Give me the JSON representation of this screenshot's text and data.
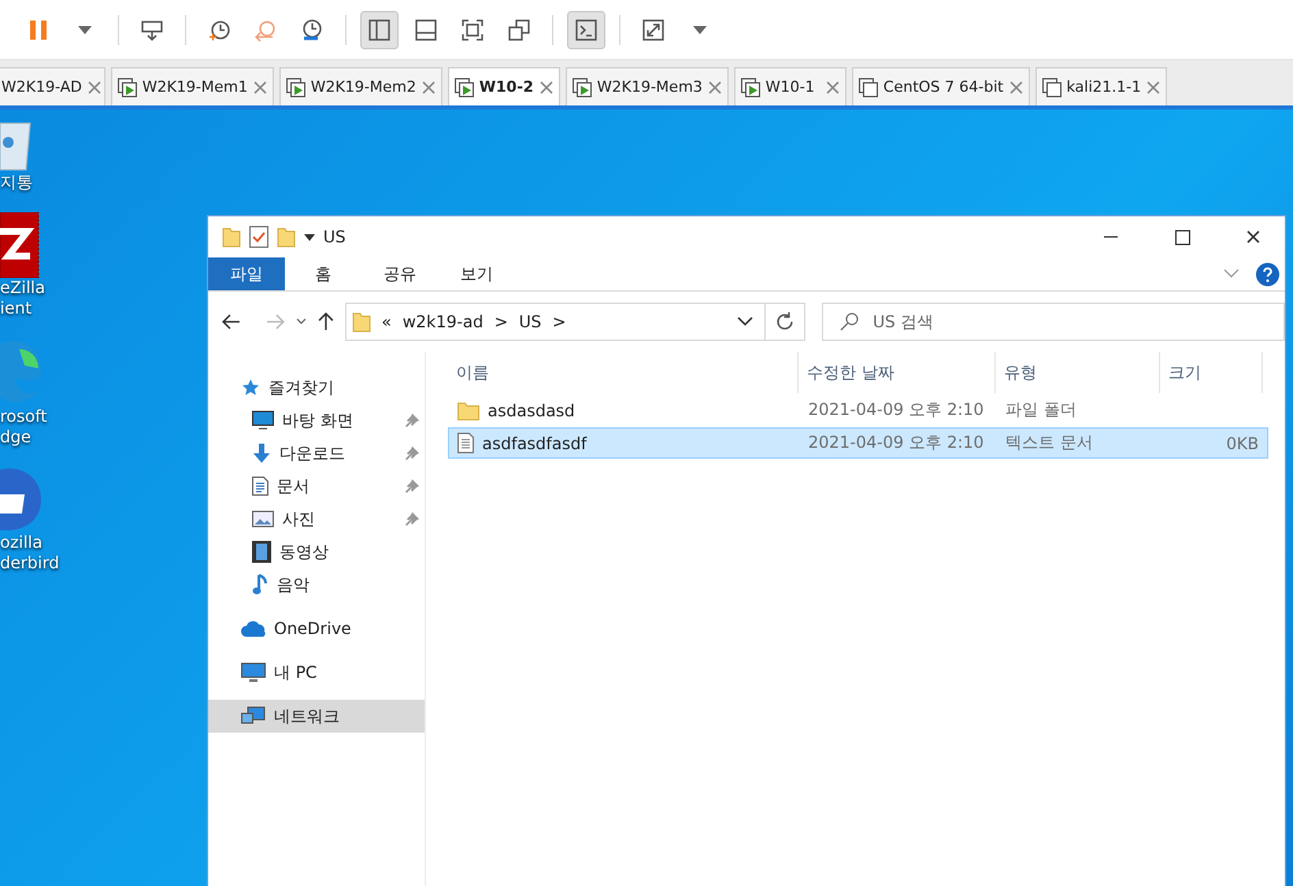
{
  "toolbar": {
    "groups": [
      [
        {
          "kind": "pause",
          "selected": false
        },
        {
          "kind": "caret",
          "selected": false
        }
      ],
      [
        {
          "kind": "send",
          "selected": false
        }
      ],
      [
        {
          "kind": "snapshot",
          "selected": false
        },
        {
          "kind": "revert",
          "selected": false
        },
        {
          "kind": "manage",
          "selected": false
        }
      ],
      [
        {
          "kind": "library",
          "selected": true
        },
        {
          "kind": "thumbs",
          "selected": false
        },
        {
          "kind": "fullscreen",
          "selected": false
        },
        {
          "kind": "unity",
          "selected": false
        }
      ],
      [
        {
          "kind": "console",
          "selected": true
        }
      ],
      [
        {
          "kind": "stretch",
          "selected": false
        },
        {
          "kind": "caret",
          "selected": false
        }
      ]
    ]
  },
  "tabs": [
    {
      "label": "W2K19-AD",
      "selected": false,
      "kind": "clipped"
    },
    {
      "label": "W2K19-Mem1",
      "selected": false,
      "kind": "running"
    },
    {
      "label": "W2K19-Mem2",
      "selected": false,
      "kind": "running"
    },
    {
      "label": "W10-2",
      "selected": true,
      "kind": "running"
    },
    {
      "label": "W2K19-Mem3",
      "selected": false,
      "kind": "running"
    },
    {
      "label": "W10-1",
      "selected": false,
      "kind": "running"
    },
    {
      "label": "CentOS 7 64-bit",
      "selected": false,
      "kind": "stopped"
    },
    {
      "label": "kali21.1-1",
      "selected": false,
      "kind": "stopped"
    }
  ],
  "desktop_icons": [
    {
      "kind": "recycle",
      "lines": [
        "지통"
      ]
    },
    {
      "kind": "filezilla",
      "lines": [
        "eZilla",
        "ient"
      ]
    },
    {
      "kind": "edge",
      "lines": [
        "rosoft",
        "dge"
      ]
    },
    {
      "kind": "thunderbird",
      "lines": [
        "ozilla",
        "derbird"
      ]
    }
  ],
  "explorer": {
    "title": "US",
    "ribbon_tabs": [
      {
        "label": "파일",
        "selected": true
      },
      {
        "label": "홈",
        "selected": false
      },
      {
        "label": "공유",
        "selected": false
      },
      {
        "label": "보기",
        "selected": false
      }
    ],
    "address": {
      "prefix": "«",
      "crumbs": [
        "w2k19-ad",
        "US"
      ],
      "separator": ">"
    },
    "search": {
      "placeholder": "US 검색"
    },
    "nav": [
      {
        "label": "즐겨찾기",
        "kind": "star",
        "selected": false,
        "children": [
          {
            "label": "바탕 화면",
            "kind": "desktop",
            "pinned": true,
            "selected": false
          },
          {
            "label": "다운로드",
            "kind": "download",
            "pinned": true,
            "selected": false
          },
          {
            "label": "문서",
            "kind": "document",
            "pinned": true,
            "selected": false
          },
          {
            "label": "사진",
            "kind": "picture",
            "pinned": true,
            "selected": false
          },
          {
            "label": "동영상",
            "kind": "video",
            "pinned": false,
            "selected": false
          },
          {
            "label": "음악",
            "kind": "music",
            "pinned": false,
            "selected": false
          }
        ]
      },
      {
        "label": "OneDrive",
        "kind": "cloud",
        "selected": false
      },
      {
        "label": "내 PC",
        "kind": "pc",
        "selected": false
      },
      {
        "label": "네트워크",
        "kind": "network",
        "selected": true
      }
    ],
    "columns": [
      "이름",
      "수정한 날짜",
      "유형",
      "크기"
    ],
    "rows": [
      {
        "kind": "folder",
        "name": "asdasdasd",
        "date": "2021-04-09 오후 2:10",
        "type": "파일 폴더",
        "selected": false
      },
      {
        "kind": "text",
        "name": "asdfasdfasdf",
        "date": "2021-04-09 오후 2:10",
        "type": "텍스트 문서",
        "size": "0KB",
        "selected": true
      }
    ]
  }
}
